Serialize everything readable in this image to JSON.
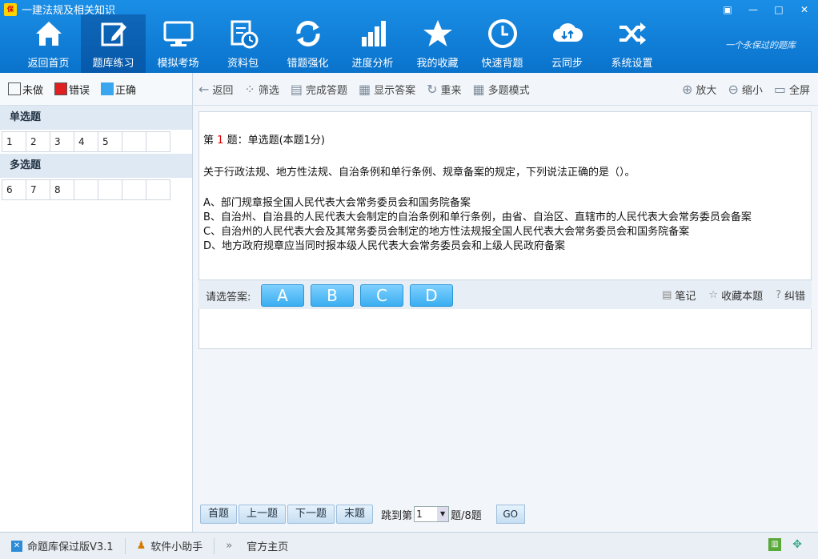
{
  "app": {
    "title": "一建法规及相关知识",
    "slogan": "一个永保过的题库",
    "window_buttons": [
      "▣",
      "—",
      "□",
      "✕"
    ]
  },
  "nav": [
    {
      "label": "返回首页",
      "icon": "home-icon"
    },
    {
      "label": "题库练习",
      "icon": "edit-icon",
      "active": true
    },
    {
      "label": "模拟考场",
      "icon": "monitor-icon"
    },
    {
      "label": "资料包",
      "icon": "document-clock-icon"
    },
    {
      "label": "错题强化",
      "icon": "refresh-icon"
    },
    {
      "label": "进度分析",
      "icon": "bar-chart-icon"
    },
    {
      "label": "我的收藏",
      "icon": "star-icon"
    },
    {
      "label": "快速背题",
      "icon": "clock-icon"
    },
    {
      "label": "云同步",
      "icon": "cloud-sync-icon"
    },
    {
      "label": "系统设置",
      "icon": "shuffle-icon"
    }
  ],
  "legend": {
    "undone": "未做",
    "wrong": "错误",
    "correct": "正确",
    "colors": {
      "wrong": "#e02020",
      "correct": "#3aa6ef"
    }
  },
  "sections": [
    {
      "title": "单选题",
      "cells": [
        "1",
        "2",
        "3",
        "4",
        "5",
        "",
        ""
      ]
    },
    {
      "title": "多选题",
      "cells": [
        "6",
        "7",
        "8",
        "",
        "",
        "",
        ""
      ]
    }
  ],
  "toolbar": {
    "back": "返回",
    "filter": "筛选",
    "finish": "完成答题",
    "show_answer": "显示答案",
    "redo": "重来",
    "multi": "多题模式",
    "zoom_in": "放大",
    "zoom_out": "缩小",
    "fullscreen": "全屏"
  },
  "question": {
    "prefix": "第",
    "number": "1",
    "header": "题：单选题(本题1分)",
    "stem": "关于行政法规、地方性法规、自治条例和单行条例、规章备案的规定，下列说法正确的是（）。",
    "options": [
      "A、部门规章报全国人民代表大会常务委员会和国务院备案",
      "B、自治州、自治县的人民代表大会制定的自治条例和单行条例，由省、自治区、直辖市的人民代表大会常务委员会备案",
      "C、自治州的人民代表大会及其常务委员会制定的地方性法规报全国人民代表大会常务委员会和国务院备案",
      "D、地方政府规章应当同时报本级人民代表大会常务委员会和上级人民政府备案"
    ]
  },
  "answer": {
    "label": "请选答案:",
    "choices": [
      "A",
      "B",
      "C",
      "D"
    ],
    "note": "笔记",
    "favorite": "收藏本题",
    "report": "纠错"
  },
  "pager": {
    "first": "首题",
    "prev": "上一题",
    "next": "下一题",
    "last": "末题",
    "jump_prefix": "跳到第",
    "jump_value": "1",
    "jump_suffix": "题/8题",
    "go": "GO"
  },
  "status": {
    "version": "命题库保过版V3.1",
    "helper": "软件小助手",
    "homepage": "官方主页"
  }
}
